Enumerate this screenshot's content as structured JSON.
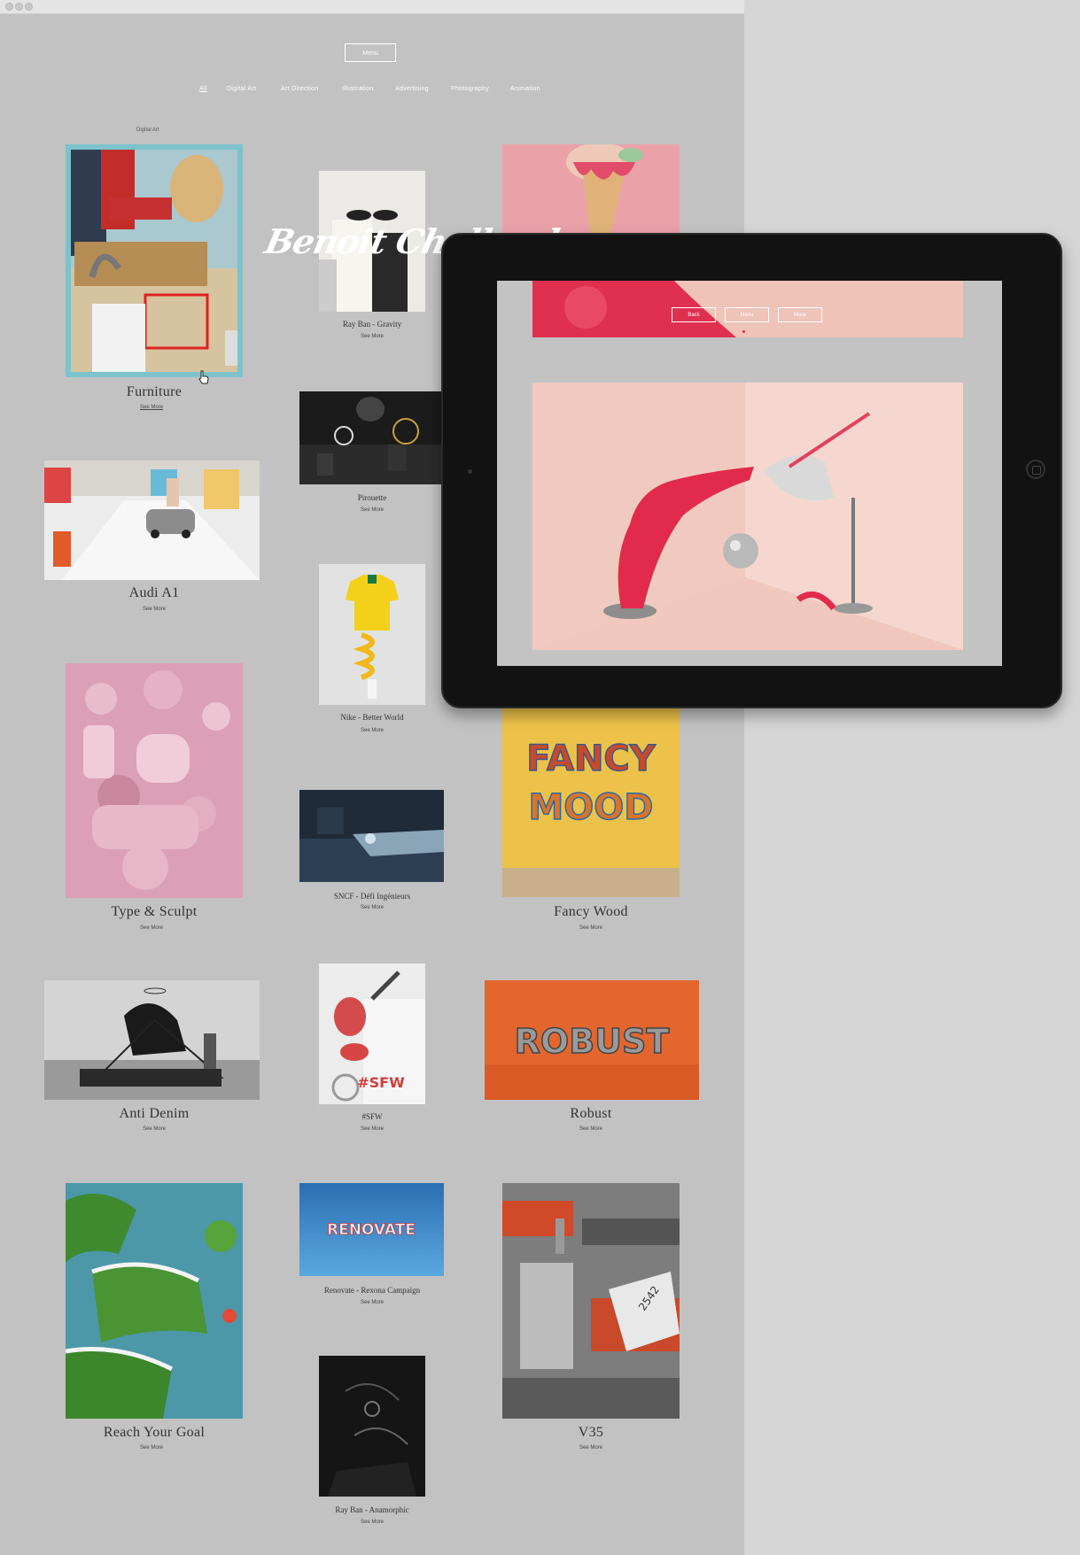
{
  "header": {
    "menu_label": "Menu",
    "nav": [
      "All",
      "Digital Art",
      "Art Direction",
      "Illustration",
      "Advertising",
      "Photography",
      "Animation"
    ],
    "category_label": "Digital Art"
  },
  "signature": "Benoit Challand",
  "projects": [
    {
      "title": "Furniture",
      "more": "See More"
    },
    {
      "title": "Ray Ban - Gravity",
      "more": "See More"
    },
    {
      "title": "Pirouette",
      "more": "See More"
    },
    {
      "title": "Audi A1",
      "more": "See More"
    },
    {
      "title": "Nike - Better World",
      "more": "See More"
    },
    {
      "title": "Type & Sculpt",
      "more": "See More"
    },
    {
      "title": "SNCF - Défi Ingénieurs",
      "more": "See More"
    },
    {
      "title": "Fancy Wood",
      "more": "See More"
    },
    {
      "title": "Anti Denim",
      "more": "See More"
    },
    {
      "title": "#SFW",
      "more": "See More"
    },
    {
      "title": "Robust",
      "more": "See More"
    },
    {
      "title": "Reach Your Goal",
      "more": "See More"
    },
    {
      "title": "Renovate - Rexona Campaign",
      "more": "See More"
    },
    {
      "title": "V35",
      "more": "See More"
    },
    {
      "title": "Ray Ban - Anamorphic",
      "more": "See More"
    }
  ],
  "artwork_text": {
    "fancy_line1": "FANCY",
    "fancy_line2": "MOOD",
    "robust": "ROBUST",
    "renovate": "RENOVATE",
    "sfw": "#SFW",
    "car_plate": "2542"
  },
  "tablet": {
    "buttons": [
      "Back",
      "Menu",
      "More"
    ]
  }
}
